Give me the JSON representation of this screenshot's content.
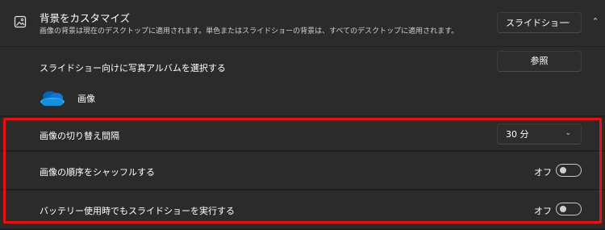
{
  "header": {
    "title": "背景をカスタマイズ",
    "description": "画像の背景は現在のデスクトップに適用されます。単色またはスライドショーの背景は、すべてのデスクトップに適用されます。",
    "dropdown_value": "スライドショー",
    "icon": "picture-icon"
  },
  "album": {
    "label": "スライドショー向けに写真アルバムを選択する",
    "button_label": "参照",
    "folder_label": "画像",
    "folder_icon": "onedrive-cloud-icon"
  },
  "interval": {
    "label": "画像の切り替え間隔",
    "value": "30 分"
  },
  "shuffle": {
    "label": "画像の順序をシャッフルする",
    "state_text": "オフ"
  },
  "battery": {
    "label": "バッテリー使用時でもスライドショーを実行する",
    "state_text": "オフ"
  },
  "colors": {
    "highlight": "#e81010",
    "cloud_dark": "#0364b8",
    "cloud_mid": "#0f78d4",
    "cloud_light": "#28a8ea"
  }
}
